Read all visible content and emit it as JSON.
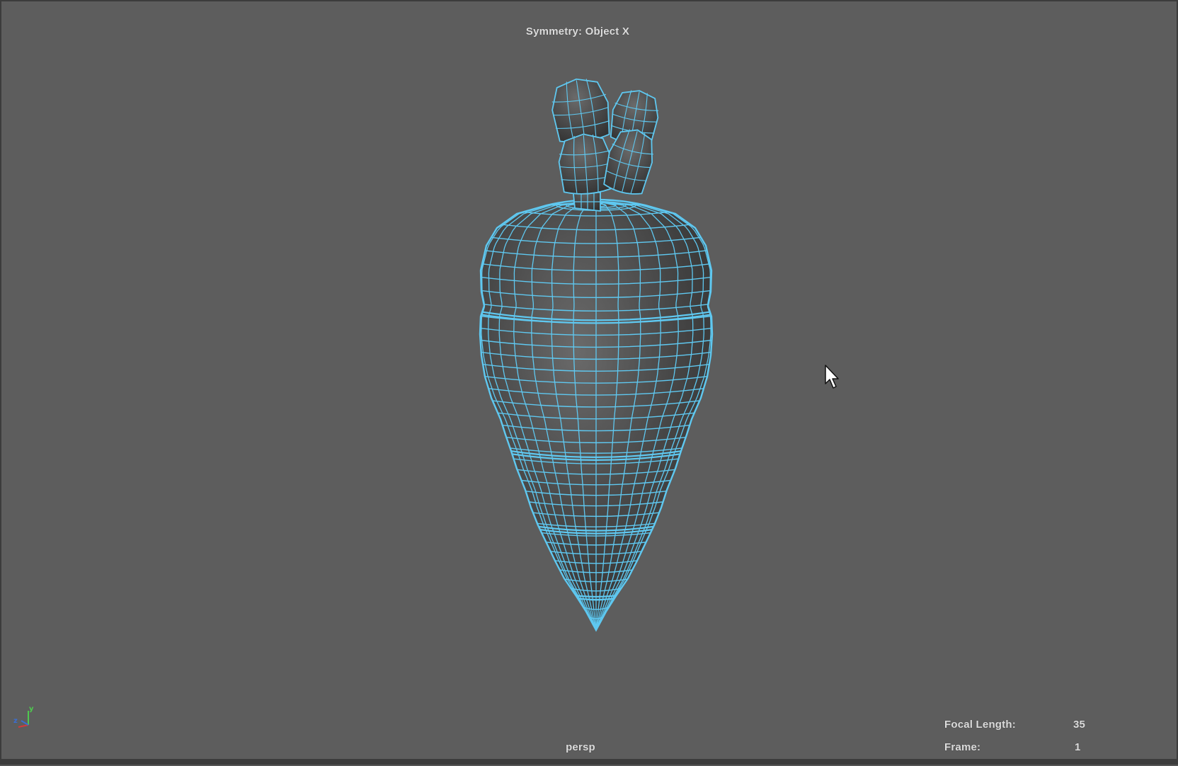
{
  "viewport": {
    "symmetry_label": "Symmetry: Object X",
    "camera_name": "persp",
    "hud": {
      "focal_length_label": "Focal Length:",
      "focal_length_value": "35",
      "frame_label": "Frame:",
      "frame_value": "1"
    },
    "axis_indicator": {
      "y": "y",
      "z": "z"
    }
  },
  "colors": {
    "viewport_background": "#5d5d5d",
    "wireframe": "#5fc8f0",
    "mesh_shading": "#4a4a4a",
    "axis_x": "#d23a3a",
    "axis_y": "#4ec94e",
    "axis_z": "#3a6ed2"
  },
  "icons": {
    "cursor": "mouse-pointer-icon",
    "axis": "view-axis-icon"
  }
}
